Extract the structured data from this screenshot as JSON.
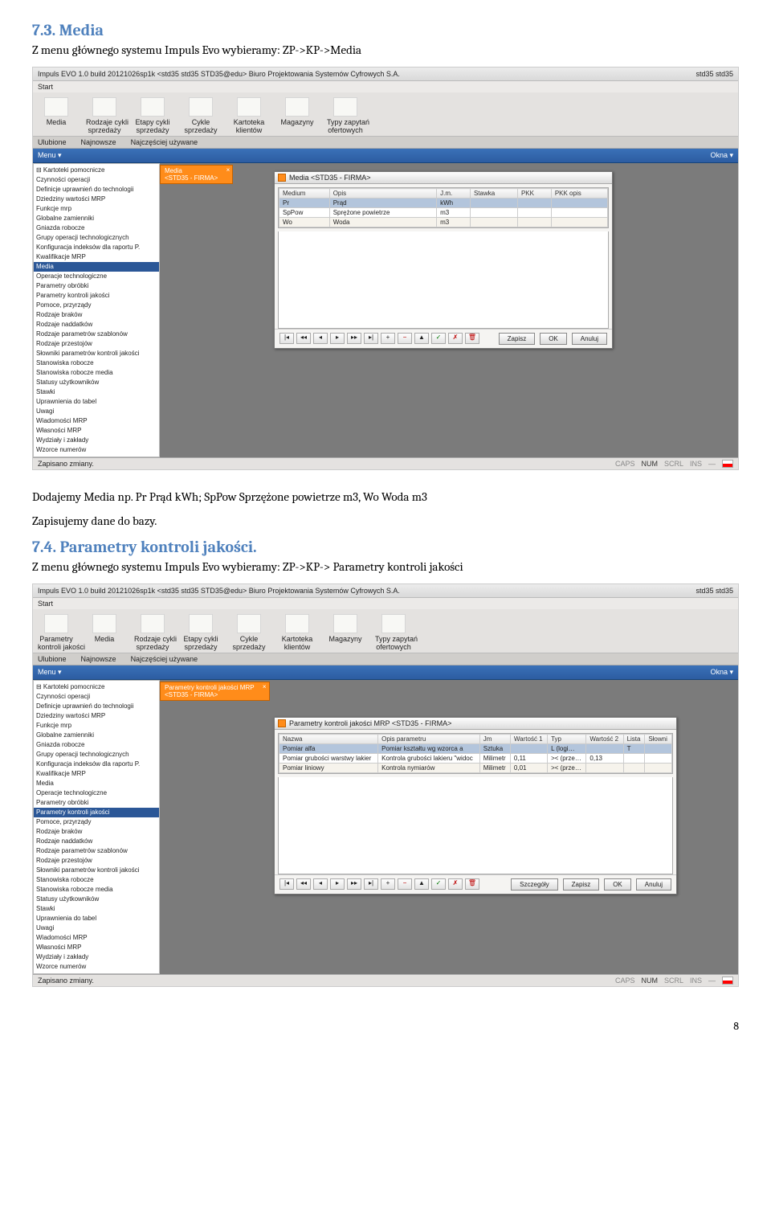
{
  "section1": {
    "heading": "7.3. Media",
    "intro": "Z menu głównego systemu Impuls Evo wybieramy: ZP->KP->Media",
    "after": "Dodajemy Media np. Pr Prąd kWh; SpPow Sprzężone powietrze m3, Wo Woda m3",
    "after2": "Zapisujemy dane do bazy."
  },
  "section2": {
    "heading": "7.4. Parametry kontroli jakości.",
    "intro": "Z menu głównego systemu Impuls Evo wybieramy: ZP->KP-> Parametry kontroli jakości"
  },
  "page_number": "8",
  "app": {
    "titlebar": "Impuls EVO 1.0 build 20121026sp1k <std35 std35 STD35@edu> Biuro Projektowania Systemów Cyfrowych S.A.",
    "user": "std35 std35",
    "start_tab": "Start",
    "ribbon1": [
      "Media",
      "Rodzaje cykli\nsprzedaży",
      "Etapy cykli\nsprzedaży",
      "Cykle\nsprzedaży",
      "Kartoteka\nklientów",
      "Magazyny",
      "Typy zapytań\nofertowych"
    ],
    "ribbon2": [
      "Parametry\nkontroli jakości",
      "Media",
      "Rodzaje cykli\nsprzedaży",
      "Etapy cykli\nsprzedaży",
      "Cykle\nsprzedaży",
      "Kartoteka\nklientów",
      "Magazyny",
      "Typy zapytań\nofertowych"
    ],
    "subbar": {
      "left": "Ulubione",
      "mid": "Najnowsze",
      "right": "Najczęściej używane"
    },
    "menu_left": "Menu  ▾",
    "menu_right": "Okna  ▾",
    "doc_tab1": "Media\n<STD35 - FIRMA>",
    "doc_tab2": "Parametry kontroli jakości MRP\n<STD35 - FIRMA>",
    "tree_root": "⊟ Kartoteki pomocnicze",
    "tree": [
      "Czynności operacji",
      "Definicje uprawnień do technologii",
      "Dziedziny wartości MRP",
      "Funkcje mrp",
      "Globalne zamienniki",
      "Gniazda robocze",
      "Grupy operacji technologicznych",
      "Konfiguracja indeksów dla raportu P.",
      "Kwalifikacje MRP",
      "Media",
      "Operacje technologiczne",
      "Parametry obróbki",
      "Parametry kontroli jakości",
      "Pomoce, przyrządy",
      "Rodzaje braków",
      "Rodzaje naddatków",
      "Rodzaje parametrów szablonów",
      "Rodzaje przestojów",
      "Słowniki parametrów kontroli jakości",
      "Stanowiska robocze",
      "Stanowiska robocze media",
      "Statusy użytkowników",
      "Stawki",
      "Uprawnienia do tabel",
      "Uwagi",
      "Wiadomości MRP",
      "Własności MRP",
      "Wydziały i zakłady",
      "Wzorce numerów"
    ],
    "win1": {
      "title": "Media <STD35 - FIRMA>",
      "columns": [
        "Medium",
        "Opis",
        "J.m.",
        "Stawka",
        "PKK",
        "PKK opis"
      ],
      "rows": [
        [
          "Pr",
          "Prąd",
          "kWh",
          "",
          "",
          ""
        ],
        [
          "SpPow",
          "Sprężone powietrze",
          "m3",
          "",
          "",
          ""
        ],
        [
          "Wo",
          "Woda",
          "m3",
          "",
          "",
          ""
        ]
      ],
      "buttons": [
        "Zapisz",
        "OK",
        "Anuluj"
      ]
    },
    "win2": {
      "title": "Parametry kontroli jakości MRP <STD35 - FIRMA>",
      "columns": [
        "Nazwa",
        "Opis parametru",
        "Jm",
        "Wartość 1",
        "Typ",
        "Wartość 2",
        "Lista",
        "Słowni"
      ],
      "rows": [
        [
          "Pomiar alfa",
          "Pomiar kształtu wg wzorca a",
          "Sztuka",
          "",
          "L (logi…",
          "",
          "T",
          ""
        ],
        [
          "Pomiar grubości warstwy lakier",
          "Kontrola grubości lakieru \"widoc",
          "Milimetr",
          "0,11",
          ">< (prze…",
          "0,13",
          "",
          ""
        ],
        [
          "Pomiar liniowy",
          "Kontrola nymiarów",
          "Milimetr",
          "0,01",
          ">< (prze…",
          "",
          "",
          ""
        ]
      ],
      "buttons": [
        "Szczegóły",
        "Zapisz",
        "OK",
        "Anuluj"
      ]
    },
    "status_left": "Zapisano zmiany.",
    "status_caps": "CAPS",
    "status_num": "NUM",
    "status_scrl": "SCRL",
    "status_ins": "INS"
  }
}
